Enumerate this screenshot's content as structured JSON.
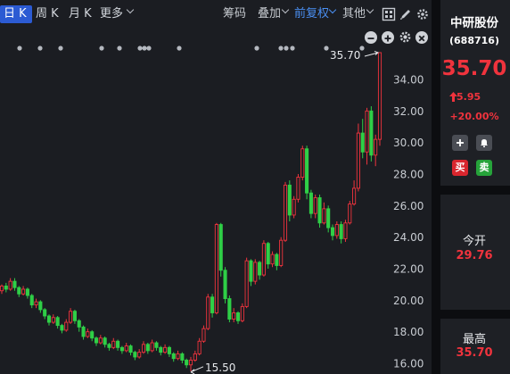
{
  "toolbar": {
    "tab_day": "日 K",
    "tab_week": "周 K",
    "tab_month": "月 K",
    "more": "更多",
    "chips": "筹码",
    "overlay": "叠加",
    "adjust": "前复权",
    "other": "其他"
  },
  "chart_data": {
    "type": "candlestick",
    "y_ticks": [
      "34.00",
      "32.00",
      "30.00",
      "28.00",
      "26.00",
      "24.00",
      "22.00",
      "20.00",
      "18.00",
      "16.00"
    ],
    "ylim": [
      15.5,
      35.8
    ],
    "high_marker": "35.70",
    "low_marker": "15.50",
    "up_color": "#f0333d",
    "down_color": "#2fcf47",
    "candles": [
      [
        20.6,
        20.9,
        21.0,
        20.4
      ],
      [
        20.9,
        20.7,
        21.1,
        20.5
      ],
      [
        20.7,
        21.2,
        21.4,
        20.6
      ],
      [
        21.2,
        20.8,
        21.4,
        20.6
      ],
      [
        20.8,
        20.4,
        20.9,
        20.2
      ],
      [
        20.4,
        20.7,
        20.9,
        20.3
      ],
      [
        20.7,
        20.3,
        20.8,
        20.1
      ],
      [
        20.3,
        19.7,
        20.4,
        19.5
      ],
      [
        19.7,
        19.9,
        20.1,
        19.5
      ],
      [
        19.9,
        19.4,
        20.0,
        19.2
      ],
      [
        19.4,
        19.0,
        19.5,
        18.8
      ],
      [
        19.0,
        18.6,
        19.1,
        18.4
      ],
      [
        18.6,
        18.9,
        19.1,
        18.5
      ],
      [
        18.9,
        18.4,
        19.0,
        18.2
      ],
      [
        18.4,
        18.1,
        18.5,
        17.9
      ],
      [
        18.1,
        18.6,
        18.8,
        18.0
      ],
      [
        18.6,
        19.3,
        19.5,
        18.5
      ],
      [
        19.3,
        18.7,
        19.4,
        18.5
      ],
      [
        18.7,
        18.3,
        18.8,
        18.0
      ],
      [
        18.3,
        17.7,
        18.4,
        17.5
      ],
      [
        17.7,
        18.0,
        18.2,
        17.6
      ],
      [
        18.0,
        17.6,
        18.1,
        17.4
      ],
      [
        17.6,
        17.3,
        17.7,
        17.1
      ],
      [
        17.3,
        17.6,
        17.8,
        17.2
      ],
      [
        17.6,
        17.2,
        17.7,
        17.0
      ],
      [
        17.2,
        17.0,
        17.3,
        16.8
      ],
      [
        17.0,
        17.4,
        17.6,
        16.9
      ],
      [
        17.4,
        17.0,
        17.5,
        16.8
      ],
      [
        17.0,
        16.8,
        17.1,
        16.6
      ],
      [
        16.8,
        17.1,
        17.3,
        16.7
      ],
      [
        17.1,
        16.7,
        17.2,
        16.5
      ],
      [
        16.7,
        16.4,
        16.8,
        16.2
      ],
      [
        16.4,
        16.7,
        16.9,
        16.3
      ],
      [
        16.7,
        17.2,
        17.4,
        16.6
      ],
      [
        17.2,
        16.8,
        17.3,
        16.6
      ],
      [
        16.8,
        17.3,
        17.5,
        16.7
      ],
      [
        17.3,
        17.0,
        17.4,
        16.8
      ],
      [
        17.0,
        16.7,
        17.1,
        16.5
      ],
      [
        16.7,
        17.0,
        17.2,
        16.6
      ],
      [
        17.0,
        16.6,
        17.1,
        16.4
      ],
      [
        16.6,
        16.3,
        16.7,
        16.1
      ],
      [
        16.3,
        16.6,
        16.8,
        16.2
      ],
      [
        16.6,
        16.2,
        16.7,
        16.0
      ],
      [
        16.2,
        15.9,
        16.3,
        15.7
      ],
      [
        15.9,
        16.2,
        16.4,
        15.5
      ],
      [
        16.2,
        16.6,
        16.8,
        16.1
      ],
      [
        16.6,
        17.4,
        17.6,
        16.5
      ],
      [
        17.4,
        18.2,
        18.4,
        17.3
      ],
      [
        18.2,
        20.2,
        20.4,
        18.1
      ],
      [
        20.2,
        19.2,
        20.4,
        18.9
      ],
      [
        19.2,
        24.8,
        24.9,
        19.1
      ],
      [
        24.8,
        21.9,
        24.9,
        21.5
      ],
      [
        21.9,
        20.1,
        22.1,
        19.8
      ],
      [
        20.1,
        18.8,
        20.3,
        18.6
      ],
      [
        18.8,
        19.2,
        19.5,
        18.6
      ],
      [
        19.2,
        18.7,
        19.3,
        18.5
      ],
      [
        18.7,
        19.6,
        19.8,
        18.6
      ],
      [
        19.6,
        22.5,
        22.7,
        19.5
      ],
      [
        22.5,
        21.2,
        22.6,
        20.9
      ],
      [
        21.2,
        22.4,
        22.6,
        21.0
      ],
      [
        22.4,
        21.6,
        22.5,
        21.3
      ],
      [
        21.6,
        23.6,
        23.8,
        21.5
      ],
      [
        23.6,
        22.3,
        23.7,
        22.0
      ],
      [
        22.3,
        22.9,
        23.1,
        22.1
      ],
      [
        22.9,
        22.2,
        23.0,
        21.9
      ],
      [
        22.2,
        23.8,
        24.0,
        22.1
      ],
      [
        23.8,
        27.3,
        27.5,
        23.7
      ],
      [
        27.3,
        25.4,
        27.6,
        25.0
      ],
      [
        25.4,
        26.4,
        26.6,
        25.2
      ],
      [
        26.4,
        27.8,
        28.0,
        26.2
      ],
      [
        27.8,
        29.6,
        29.8,
        27.6
      ],
      [
        29.6,
        26.8,
        29.8,
        26.4
      ],
      [
        26.8,
        25.5,
        27.0,
        25.2
      ],
      [
        25.5,
        26.5,
        26.7,
        25.2
      ],
      [
        26.5,
        24.9,
        26.7,
        24.6
      ],
      [
        24.9,
        25.8,
        26.2,
        24.8
      ],
      [
        25.8,
        24.6,
        26.0,
        24.3
      ],
      [
        24.6,
        24.1,
        24.8,
        23.8
      ],
      [
        24.1,
        24.8,
        25.0,
        23.9
      ],
      [
        24.8,
        23.9,
        25.0,
        23.6
      ],
      [
        23.9,
        24.9,
        25.1,
        23.7
      ],
      [
        24.9,
        26.1,
        26.3,
        24.8
      ],
      [
        26.1,
        27.1,
        27.6,
        26.0
      ],
      [
        27.1,
        30.6,
        31.2,
        26.9
      ],
      [
        30.6,
        29.4,
        31.5,
        29.0
      ],
      [
        29.4,
        32.0,
        32.2,
        28.6
      ],
      [
        32.0,
        29.2,
        32.3,
        28.8
      ],
      [
        29.2,
        30.2,
        30.5,
        28.5
      ],
      [
        30.2,
        35.7,
        35.7,
        29.8
      ]
    ]
  },
  "panel": {
    "name": "中研股份",
    "code": "(688716)",
    "price": "35.70",
    "change": "5.95",
    "pct": "+20.00%",
    "buy": "买",
    "sell": "卖",
    "open_label": "今开",
    "open_value": "29.76",
    "high_label": "最高",
    "high_value": "35.70"
  }
}
